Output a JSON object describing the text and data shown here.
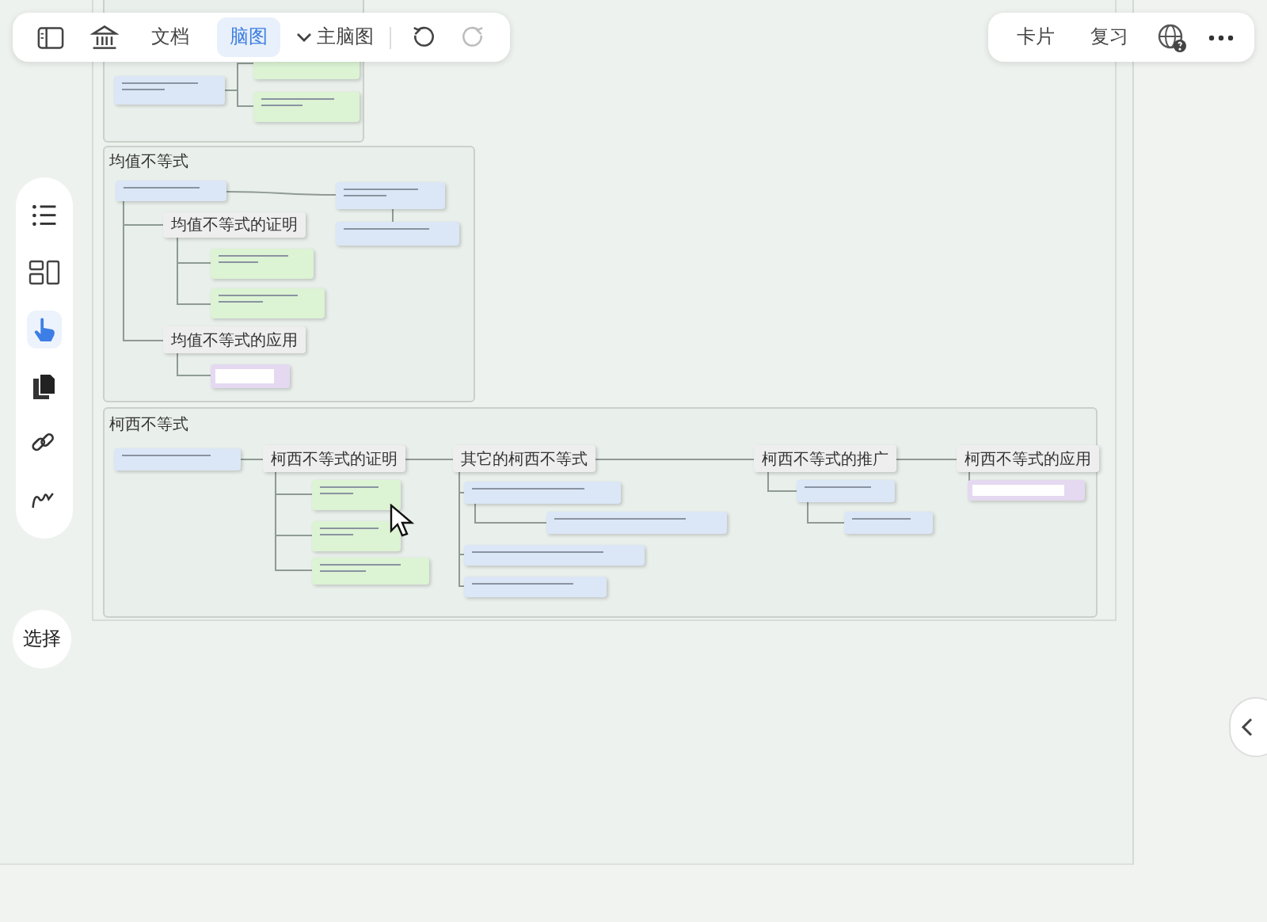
{
  "top_toolbar": {
    "items": [
      {
        "kind": "sidebar_toggle"
      },
      {
        "kind": "library"
      },
      {
        "kind": "tab",
        "label": "文档",
        "selected": false
      },
      {
        "kind": "tab",
        "label": "脑图",
        "selected": true
      },
      {
        "kind": "dropdown",
        "label": "主脑图"
      },
      {
        "kind": "divider"
      },
      {
        "kind": "undo",
        "disabled": false
      },
      {
        "kind": "redo",
        "disabled": true
      }
    ]
  },
  "right_toolbar": {
    "items": [
      {
        "kind": "button",
        "label": "卡片"
      },
      {
        "kind": "button",
        "label": "复习"
      },
      {
        "kind": "web"
      },
      {
        "kind": "more"
      }
    ]
  },
  "side_tools": [
    {
      "kind": "outline",
      "selected": false
    },
    {
      "kind": "layout",
      "selected": false
    },
    {
      "kind": "hand",
      "selected": true
    },
    {
      "kind": "copy",
      "selected": false
    },
    {
      "kind": "link",
      "selected": false
    },
    {
      "kind": "pen",
      "selected": false
    }
  ],
  "select_button": {
    "label": "选择"
  },
  "frames": [
    {
      "nodes": [
        {
          "kind": "note",
          "color": "#dbe6f6"
        },
        {
          "kind": "note",
          "color": "#dcf3d4"
        },
        {
          "kind": "note",
          "color": "#dcf3d4"
        }
      ]
    },
    {
      "title": "均值不等式",
      "nodes": [
        {
          "kind": "note",
          "color": "#dbe6f6"
        },
        {
          "kind": "topic",
          "text": "均值不等式的证明"
        },
        {
          "kind": "note",
          "color": "#dcf3d4"
        },
        {
          "kind": "note",
          "color": "#dcf3d4"
        },
        {
          "kind": "topic",
          "text": "均值不等式的应用"
        },
        {
          "kind": "blank",
          "color": "#e4d9f0"
        },
        {
          "kind": "note",
          "color": "#dbe6f6"
        },
        {
          "kind": "note",
          "color": "#dbe6f6"
        }
      ]
    },
    {
      "title": "柯西不等式",
      "nodes": [
        {
          "kind": "note",
          "color": "#dbe6f6"
        },
        {
          "kind": "topic",
          "text": "柯西不等式的证明"
        },
        {
          "kind": "topic",
          "text": "其它的柯西不等式"
        },
        {
          "kind": "topic",
          "text": "柯西不等式的推广"
        },
        {
          "kind": "topic",
          "text": "柯西不等式的应用"
        },
        {
          "kind": "note",
          "color": "#dcf3d4"
        },
        {
          "kind": "note",
          "color": "#dcf3d4"
        },
        {
          "kind": "note",
          "color": "#dcf3d4"
        },
        {
          "kind": "note",
          "color": "#dbe6f6"
        },
        {
          "kind": "note",
          "color": "#dbe6f6"
        },
        {
          "kind": "note",
          "color": "#dbe6f6"
        },
        {
          "kind": "note",
          "color": "#dbe6f6"
        },
        {
          "kind": "note",
          "color": "#dbe6f6"
        },
        {
          "kind": "note",
          "color": "#dbe6f6"
        },
        {
          "kind": "blank",
          "color": "#e4d9f0"
        }
      ]
    }
  ]
}
